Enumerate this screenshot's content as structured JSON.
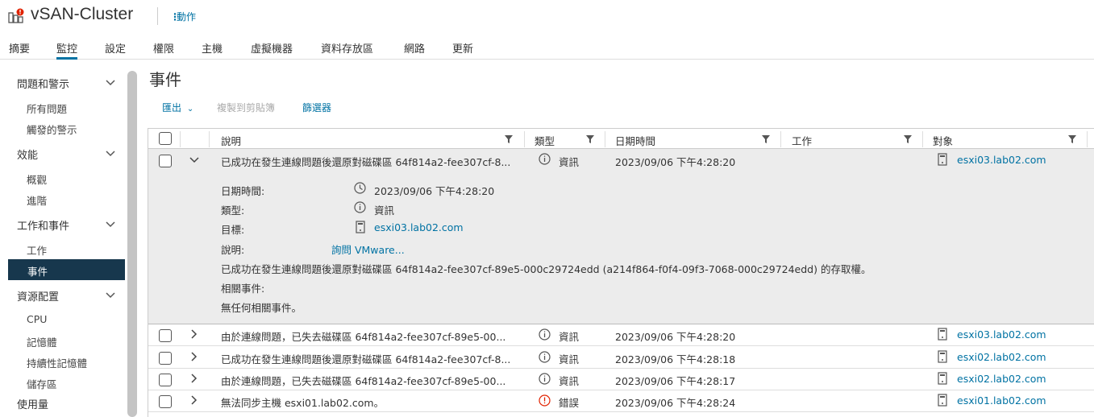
{
  "header": {
    "title": "vSAN-Cluster",
    "actions_label": "動作"
  },
  "tabs": [
    "摘要",
    "監控",
    "設定",
    "權限",
    "主機",
    "虛擬機器",
    "資料存放區",
    "網路",
    "更新"
  ],
  "active_tab": "監控",
  "sidebar": {
    "groups": [
      {
        "label": "問題和警示",
        "items": [
          "所有問題",
          "觸發的警示"
        ]
      },
      {
        "label": "效能",
        "items": [
          "概觀",
          "進階"
        ]
      },
      {
        "label": "工作和事件",
        "items": [
          "工作",
          "事件"
        ]
      },
      {
        "label": "資源配置",
        "items": [
          "CPU",
          "記憶體",
          "持續性記憶體",
          "儲存區"
        ]
      },
      {
        "label": "使用量",
        "items": []
      }
    ],
    "active_item": "事件"
  },
  "main": {
    "title": "事件",
    "toolbar": {
      "export": "匯出",
      "copy": "複製到剪貼簿",
      "filter": "篩選器"
    },
    "columns": {
      "description": "說明",
      "type": "類型",
      "datetime": "日期時間",
      "task": "工作",
      "target": "對象"
    },
    "expanded_event": {
      "description": "已成功在發生連線問題後還原對磁碟區 64f814a2-fee307cf-8...",
      "type": "資訊",
      "datetime": "2023/09/06 下午4:28:20",
      "target": "esxi03.lab02.com",
      "details": {
        "datetime_label": "日期時間:",
        "datetime_value": "2023/09/06 下午4:28:20",
        "type_label": "類型:",
        "type_value": "資訊",
        "target_label": "目標:",
        "target_value": "esxi03.lab02.com",
        "description_label": "說明:",
        "ask_vmware": "詢問 VMware...",
        "full_description": "已成功在發生連線問題後還原對磁碟區 64f814a2-fee307cf-89e5-000c29724edd (a214f864-f0f4-09f3-7068-000c29724edd) 的存取權。",
        "related_label": "相關事件:",
        "related_value": "無任何相關事件。"
      }
    },
    "rows": [
      {
        "description": "由於連線問題，已失去磁碟區 64f814a2-fee307cf-89e5-00...",
        "type": "資訊",
        "datetime": "2023/09/06 下午4:28:20",
        "target": "esxi03.lab02.com",
        "severity": "info"
      },
      {
        "description": "已成功在發生連線問題後還原對磁碟區 64f814a2-fee307cf-8...",
        "type": "資訊",
        "datetime": "2023/09/06 下午4:28:18",
        "target": "esxi02.lab02.com",
        "severity": "info"
      },
      {
        "description": "由於連線問題，已失去磁碟區 64f814a2-fee307cf-89e5-00...",
        "type": "資訊",
        "datetime": "2023/09/06 下午4:28:17",
        "target": "esxi02.lab02.com",
        "severity": "info"
      },
      {
        "description": "無法同步主機 esxi01.lab02.com。",
        "type": "錯誤",
        "datetime": "2023/09/06 下午4:28:24",
        "target": "esxi01.lab02.com",
        "severity": "error"
      }
    ]
  },
  "colors": {
    "accent": "#0072a3",
    "active_nav": "#17374d",
    "error": "#e12200",
    "expanded_bg": "#ececec"
  }
}
